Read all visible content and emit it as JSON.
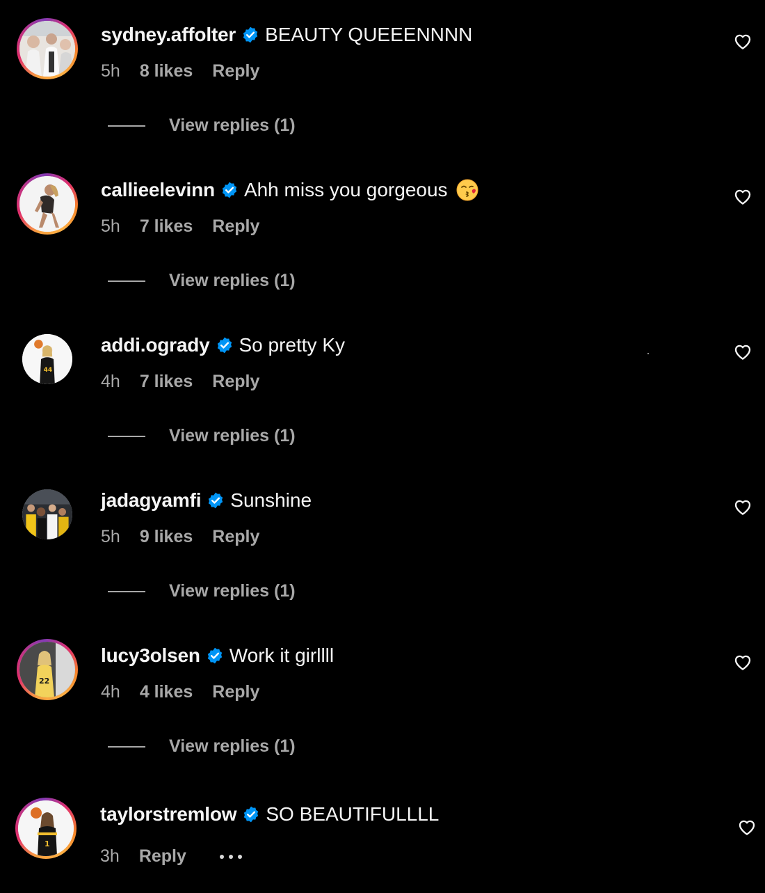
{
  "colors": {
    "background": "#000000",
    "primary_text": "#f5f5f5",
    "secondary_text": "#a8a8a8",
    "verified_blue": "#0095f6"
  },
  "comments": [
    {
      "username": "sydney.affolter",
      "verified": true,
      "text": "BEAUTY QUEEENNNN",
      "time": "5h",
      "likes": "8 likes",
      "reply_label": "Reply",
      "view_replies": "View replies (1)",
      "avatar_icon": "user-photo-avatar",
      "story_ring": true
    },
    {
      "username": "callieelevinn",
      "verified": true,
      "text": "Ahh miss you gorgeous",
      "emoji": "kissing-face-emoji",
      "time": "5h",
      "likes": "7 likes",
      "reply_label": "Reply",
      "view_replies": "View replies (1)",
      "avatar_icon": "user-photo-avatar",
      "story_ring": true
    },
    {
      "username": "addi.ogrady",
      "verified": true,
      "text": "So pretty Ky",
      "time": "4h",
      "likes": "7 likes",
      "reply_label": "Reply",
      "view_replies": "View replies (1)",
      "avatar_icon": "user-photo-avatar",
      "story_ring": false
    },
    {
      "username": "jadagyamfi",
      "verified": true,
      "text": "Sunshine",
      "time": "5h",
      "likes": "9 likes",
      "reply_label": "Reply",
      "view_replies": "View replies (1)",
      "avatar_icon": "user-photo-avatar",
      "story_ring": false
    },
    {
      "username": "lucy3olsen",
      "verified": true,
      "text": "Work it girllll",
      "time": "4h",
      "likes": "4 likes",
      "reply_label": "Reply",
      "view_replies": "View replies (1)",
      "avatar_icon": "user-photo-avatar",
      "story_ring": true
    },
    {
      "username": "taylorstremlow",
      "verified": true,
      "text": "SO BEAUTIFULLLL",
      "time": "3h",
      "reply_label": "Reply",
      "more_icon": "more-options-icon",
      "avatar_icon": "user-photo-avatar",
      "story_ring": true
    }
  ],
  "icons": {
    "like": "heart-icon",
    "verified": "verified-badge-icon"
  }
}
